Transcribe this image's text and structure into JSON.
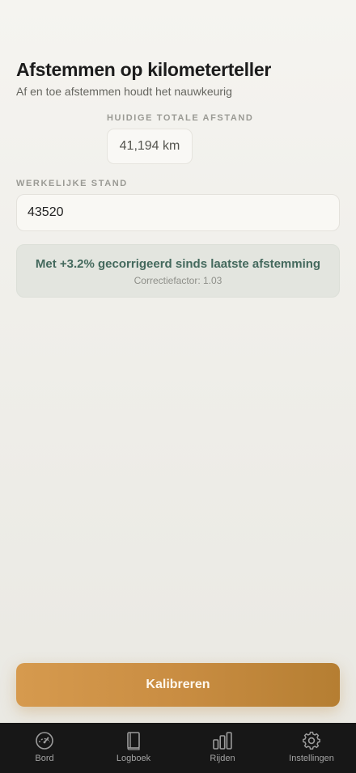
{
  "header": {
    "title": "Afstemmen op kilometerteller",
    "subtitle": "Af en toe afstemmen houdt het nauwkeurig"
  },
  "total": {
    "label": "HUIDIGE TOTALE AFSTAND",
    "value": "41,194 km"
  },
  "actual": {
    "label": "WERKELIJKE STAND",
    "value": "43520"
  },
  "notice": {
    "main": "Met +3.2% gecorrigeerd sinds laatste afstemming",
    "sub": "Correctiefactor: 1.03"
  },
  "cta": {
    "label": "Kalibreren",
    "color": "#c98d42"
  },
  "tabs": [
    {
      "label": "Bord",
      "icon": "gauge-icon"
    },
    {
      "label": "Logboek",
      "icon": "book-icon"
    },
    {
      "label": "Rijden",
      "icon": "bar-chart-icon"
    },
    {
      "label": "Instellingen",
      "icon": "gear-icon"
    }
  ],
  "colors": {
    "accent": "#c98d42",
    "notice_text": "#44695d",
    "tabbar_bg": "#171717"
  }
}
